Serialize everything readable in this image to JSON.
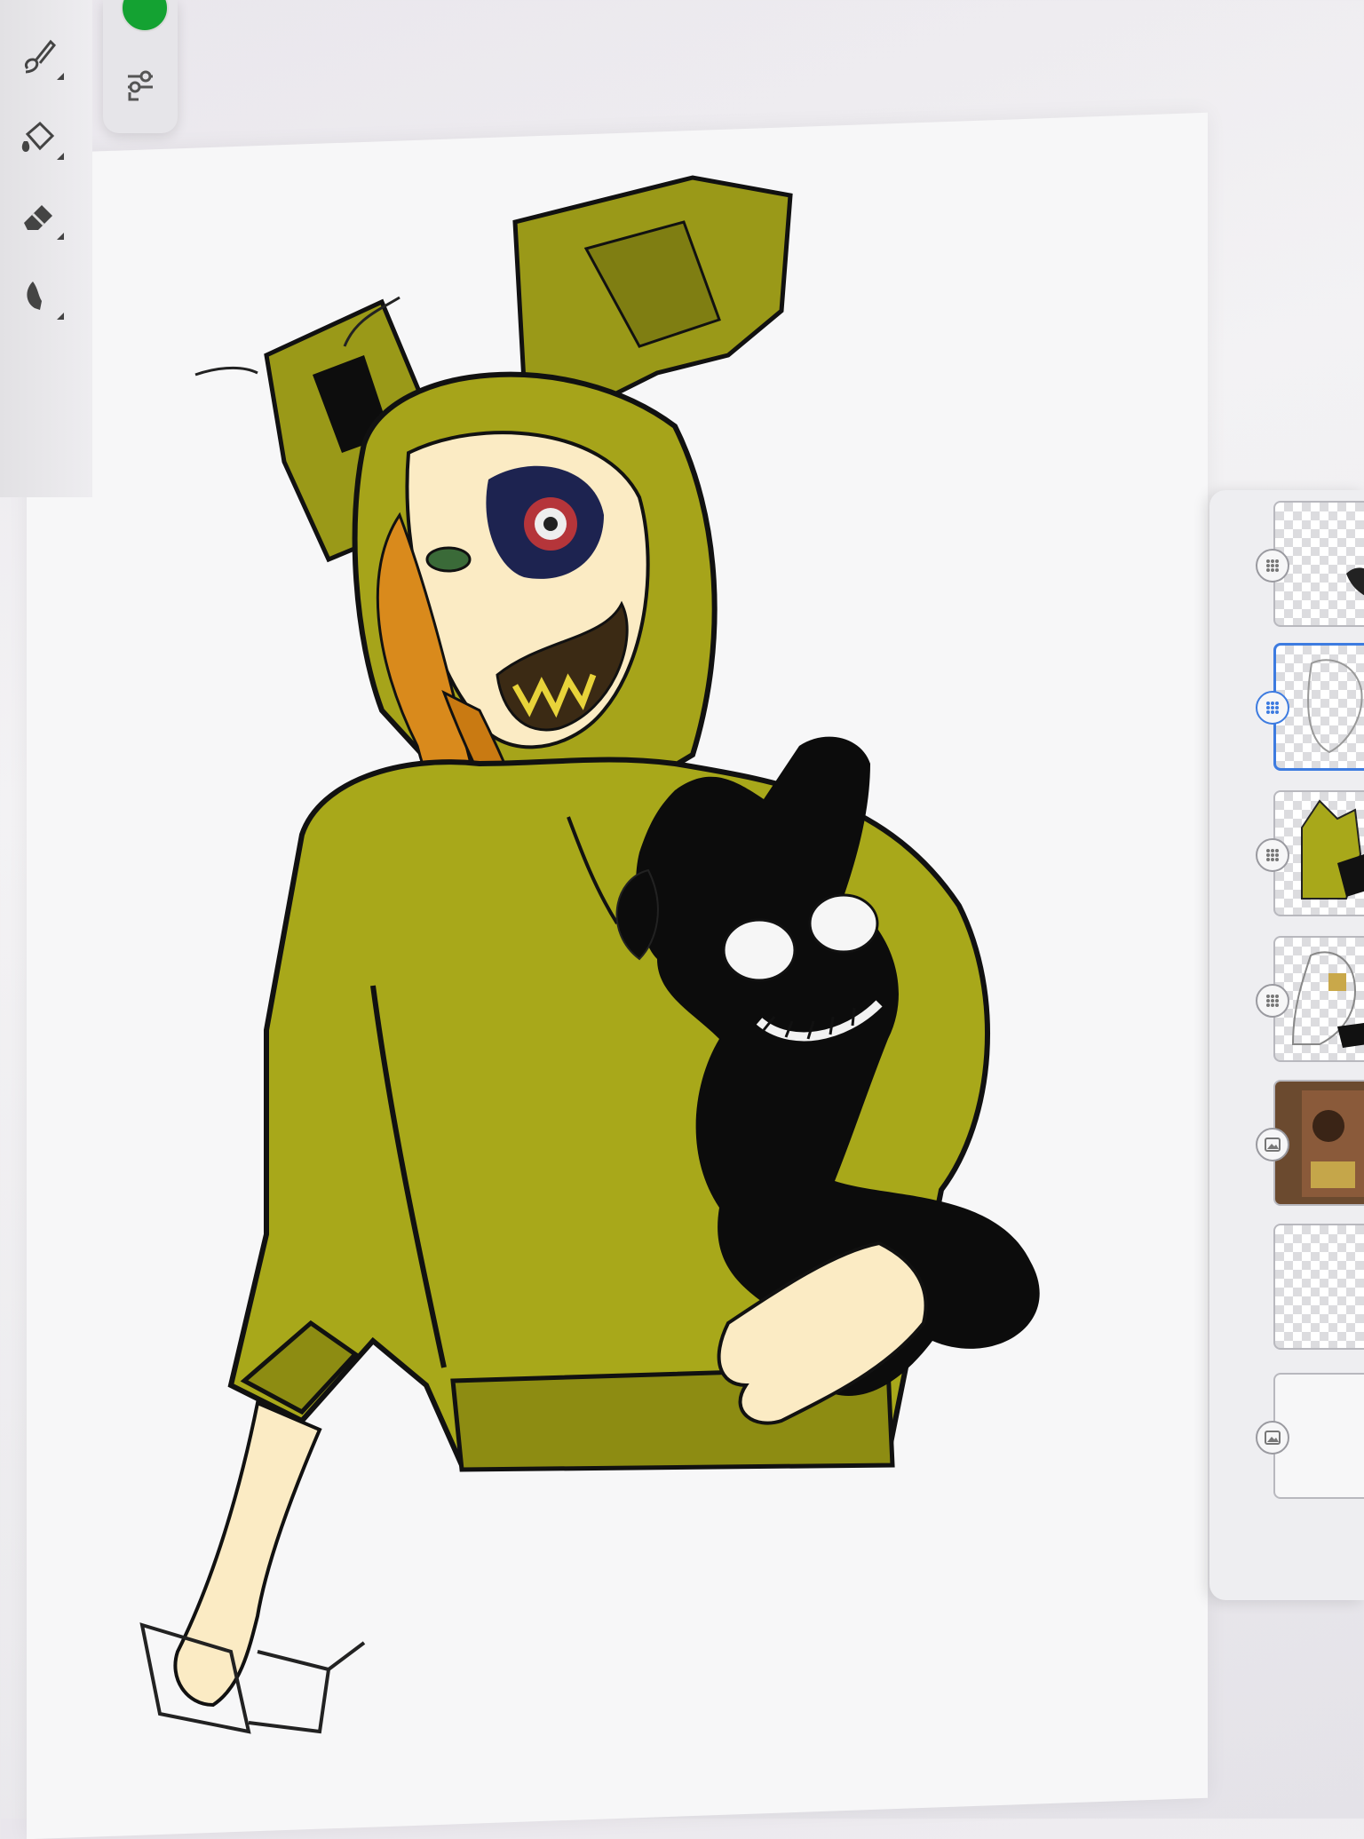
{
  "app": {
    "name": ""
  },
  "colors": {
    "active_color": "#14a232",
    "selection": "#3d7be0",
    "hoodie": "#a8a81a",
    "hoodie_dark": "#8d8c12",
    "skin": "#fbebc4",
    "hair": "#d98a1c",
    "plush": "#0c0c0c"
  },
  "tools": [
    {
      "name": "brush-tool",
      "icon": "paintbrush-icon"
    },
    {
      "name": "fill-tool",
      "icon": "paint-bucket-icon"
    },
    {
      "name": "eraser-tool",
      "icon": "eraser-icon"
    },
    {
      "name": "smudge-tool",
      "icon": "smudge-icon"
    }
  ],
  "side_panel": {
    "adjust_icon": "sliders-icon"
  },
  "layers": [
    {
      "type": "layer-group",
      "icon": "grid-icon",
      "selected": false
    },
    {
      "type": "layer-group",
      "icon": "grid-icon",
      "selected": true
    },
    {
      "type": "layer-group",
      "icon": "grid-icon",
      "selected": false
    },
    {
      "type": "layer-group",
      "icon": "grid-icon",
      "selected": false
    },
    {
      "type": "image-layer",
      "icon": "image-icon",
      "selected": false
    },
    {
      "type": "empty-layer",
      "icon": "",
      "selected": false
    },
    {
      "type": "image-layer",
      "icon": "image-icon",
      "selected": false
    }
  ]
}
